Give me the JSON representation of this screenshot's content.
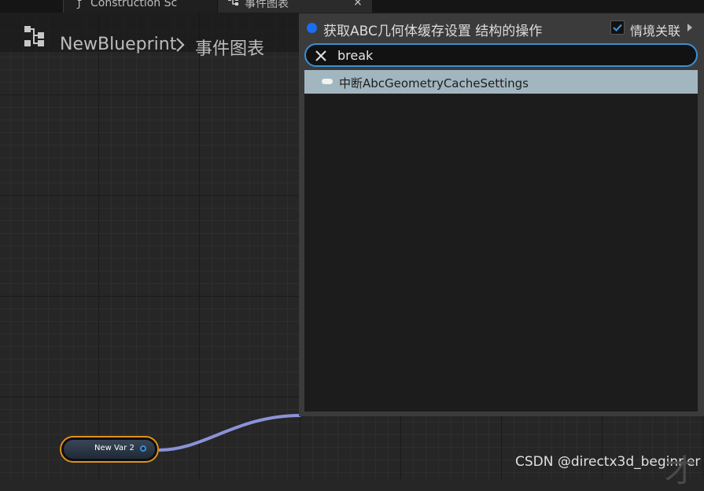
{
  "tabs": {
    "construction_label": "Construction Sc",
    "event_graph_label": "事件图表",
    "close_glyph": "×"
  },
  "breadcrumb": {
    "blueprint_name": "NewBlueprint",
    "graph_name": "事件图表"
  },
  "action_menu": {
    "title": "获取ABC几何体缓存设置 结构的操作",
    "context_sensitive_label": "情境关联",
    "context_sensitive_checked": true,
    "search_value": "break",
    "results": [
      {
        "label": "中断AbcGeometryCacheSettings"
      }
    ]
  },
  "node": {
    "label": "New Var 2"
  },
  "watermark": "CSDN @directx3d_beginner",
  "colors": {
    "title_dot": "#1a6ef0",
    "search_border": "#3a8fd6",
    "node_border": "#e2901a",
    "wire": "#8a93d8",
    "result_highlight": "#a2b6bf"
  }
}
